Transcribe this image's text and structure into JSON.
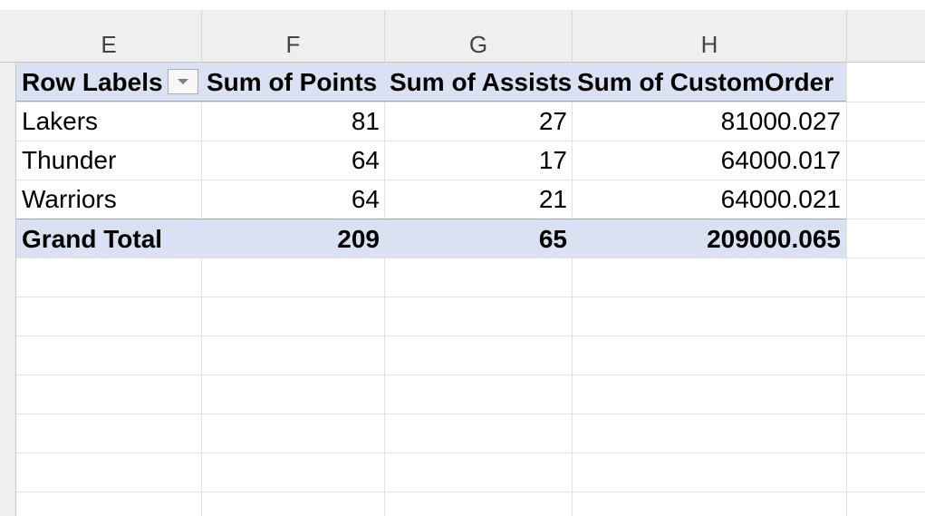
{
  "columns": [
    "E",
    "F",
    "G",
    "H"
  ],
  "pivot": {
    "headers": {
      "row_labels": "Row Labels",
      "points": "Sum of Points",
      "assists": "Sum of Assists",
      "custom_order": "Sum of CustomOrder"
    },
    "rows": [
      {
        "label": "Lakers",
        "points": "81",
        "assists": "27",
        "custom_order": "81000.027"
      },
      {
        "label": "Thunder",
        "points": "64",
        "assists": "17",
        "custom_order": "64000.017"
      },
      {
        "label": "Warriors",
        "points": "64",
        "assists": "21",
        "custom_order": "64000.021"
      }
    ],
    "total": {
      "label": "Grand Total",
      "points": "209",
      "assists": "65",
      "custom_order": "209000.065"
    }
  },
  "icons": {
    "filter_dropdown": "chevron-down-icon"
  },
  "colors": {
    "pivot_header_fill": "#d9e1f2",
    "pivot_border": "#8ea9db"
  }
}
